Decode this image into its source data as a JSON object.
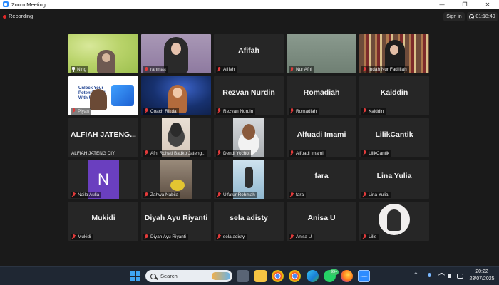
{
  "window": {
    "title": "Zoom Meeting",
    "minimize": "—",
    "maximize": "❐",
    "close": "✕"
  },
  "topbar": {
    "recording_label": "Recording",
    "signin_label": "Sign in",
    "timer": "01:18:49"
  },
  "tiles": [
    {
      "name": "Ning",
      "big": "",
      "kind": "ning",
      "pinned": true,
      "active": true
    },
    {
      "name": "rahmaa",
      "big": "",
      "kind": "rahmaa"
    },
    {
      "name": "Afifah",
      "big": "Afifah",
      "kind": "text"
    },
    {
      "name": "Nur Afni",
      "big": "",
      "kind": "nurafni"
    },
    {
      "name": "Indah Nur Fadlillah",
      "big": "",
      "kind": "indah"
    },
    {
      "name": "Piyan",
      "big": "",
      "kind": "piyan",
      "slide_text": "Unlock Your Potential Skill With Us"
    },
    {
      "name": "Coach Rikda",
      "big": "",
      "kind": "coach"
    },
    {
      "name": "Rezvan Nurdin",
      "big": "Rezvan Nurdin",
      "kind": "text"
    },
    {
      "name": "Romadiah",
      "big": "Romadiah",
      "kind": "text"
    },
    {
      "name": "Kaiddin",
      "big": "Kaiddin",
      "kind": "text"
    },
    {
      "name": "ALFIAH JATENG DIY",
      "big": "ALFIAH JATENG...",
      "kind": "text",
      "plain_name": true
    },
    {
      "name": "Afni Rohati Badko Jateng...",
      "big": "",
      "kind": "afni"
    },
    {
      "name": "Dendi Yocho",
      "big": "",
      "kind": "dendi"
    },
    {
      "name": "Alfuadi Imami",
      "big": "Alfuadi Imami",
      "kind": "text"
    },
    {
      "name": "LilikCantik",
      "big": "LilikCantik",
      "kind": "text"
    },
    {
      "name": "Naila Aulia",
      "big": "",
      "kind": "naila",
      "initial": "N"
    },
    {
      "name": "Zahwa Nabila",
      "big": "",
      "kind": "zahwa"
    },
    {
      "name": "Ulfatur Rohmah",
      "big": "",
      "kind": "ulfatur"
    },
    {
      "name": "fara",
      "big": "fara",
      "kind": "text"
    },
    {
      "name": "Lina Yulia",
      "big": "Lina Yulia",
      "kind": "text"
    },
    {
      "name": "Mukidi",
      "big": "Mukidi",
      "kind": "text"
    },
    {
      "name": "Diyah Ayu Riyanti",
      "big": "Diyah Ayu Riyanti",
      "kind": "text"
    },
    {
      "name": "sela adisty",
      "big": "sela adisty",
      "kind": "text"
    },
    {
      "name": "Anisa U",
      "big": "Anisa U",
      "kind": "text"
    },
    {
      "name": "Lilis",
      "big": "",
      "kind": "lilis"
    }
  ],
  "taskbar": {
    "search_label": "Search",
    "whatsapp_badge": "99+",
    "time": "20:22",
    "date": "23/07/2025",
    "icons": [
      "start-icon",
      "search-icon",
      "task-view-icon",
      "file-explorer-icon",
      "chrome-icon",
      "chrome-profile-icon",
      "edge-icon",
      "whatsapp-icon",
      "firefox-icon",
      "zoom-icon"
    ]
  },
  "colors": {
    "active_speaker": "#c8e85a",
    "muted_mic": "#e23b3b",
    "recording_dot": "#e02828",
    "tile_bg": "#262626"
  }
}
